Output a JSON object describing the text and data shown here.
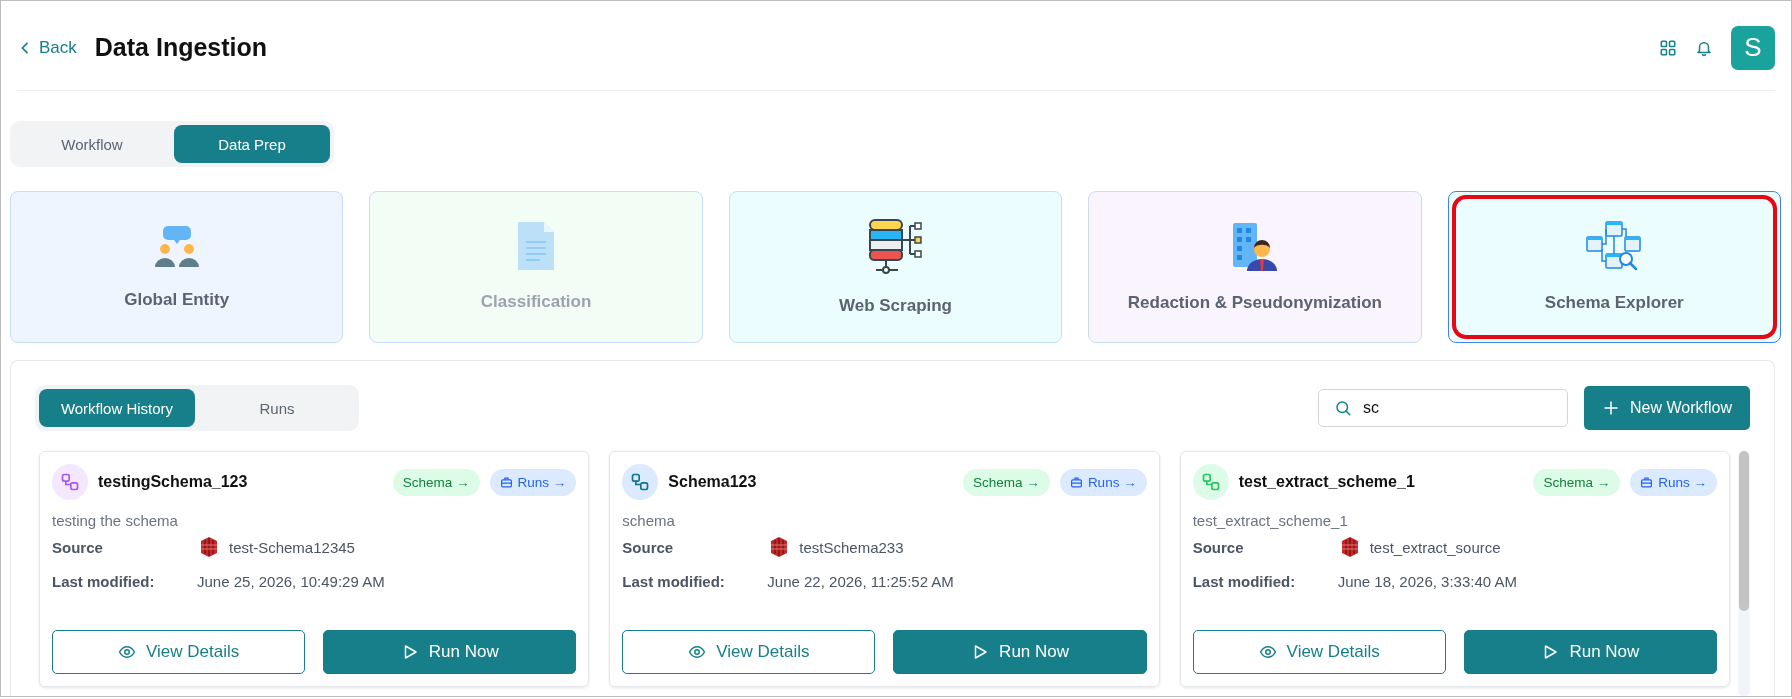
{
  "header": {
    "back": "Back",
    "title": "Data Ingestion",
    "avatar": "S"
  },
  "mode_tabs": [
    {
      "label": "Workflow",
      "selected": false
    },
    {
      "label": "Data Prep",
      "selected": true
    }
  ],
  "tools": [
    {
      "label": "Global Entity",
      "color": "#eff5ff",
      "disabled": false,
      "selected": false
    },
    {
      "label": "Classification",
      "color": "#f2fdf6",
      "disabled": true,
      "selected": false
    },
    {
      "label": "Web Scraping",
      "color": "#ebfdfe",
      "disabled": false,
      "selected": false
    },
    {
      "label": "Redaction & Pseudonymization",
      "color": "#faf4fe",
      "disabled": false,
      "selected": false
    },
    {
      "label": "Schema Explorer",
      "color": "#ebfdfe",
      "disabled": false,
      "selected": true
    }
  ],
  "history_tabs": [
    {
      "label": "Workflow History",
      "selected": true
    },
    {
      "label": "Runs",
      "selected": false
    }
  ],
  "search": {
    "value": "sc"
  },
  "new_button": "New Workflow",
  "workflows": [
    {
      "name": "testingSchema_123",
      "color": "#f3e8ff",
      "schema_tag": "Schema →",
      "runs_tag": "Runs →",
      "description": "testing the schema",
      "source_label": "Source",
      "source": "test-Schema12345",
      "modified_label": "Last modified:",
      "modified": "June 25, 2026, 10:49:29 AM",
      "view": "View Details",
      "run": "Run Now"
    },
    {
      "name": "Schema123",
      "color": "#dbeafe",
      "schema_tag": "Schema →",
      "runs_tag": "Runs →",
      "description": "schema",
      "source_label": "Source",
      "source": "testSchema233",
      "modified_label": "Last modified:",
      "modified": "June 22, 2026, 11:25:52 AM",
      "view": "View Details",
      "run": "Run Now"
    },
    {
      "name": "test_extract_scheme_1",
      "color": "#dcfce7",
      "schema_tag": "Schema →",
      "runs_tag": "Runs →",
      "description": "test_extract_scheme_1",
      "source_label": "Source",
      "source": "test_extract_source",
      "modified_label": "Last modified:",
      "modified": "June 18, 2026, 3:33:40 AM",
      "view": "View Details",
      "run": "Run Now"
    }
  ]
}
